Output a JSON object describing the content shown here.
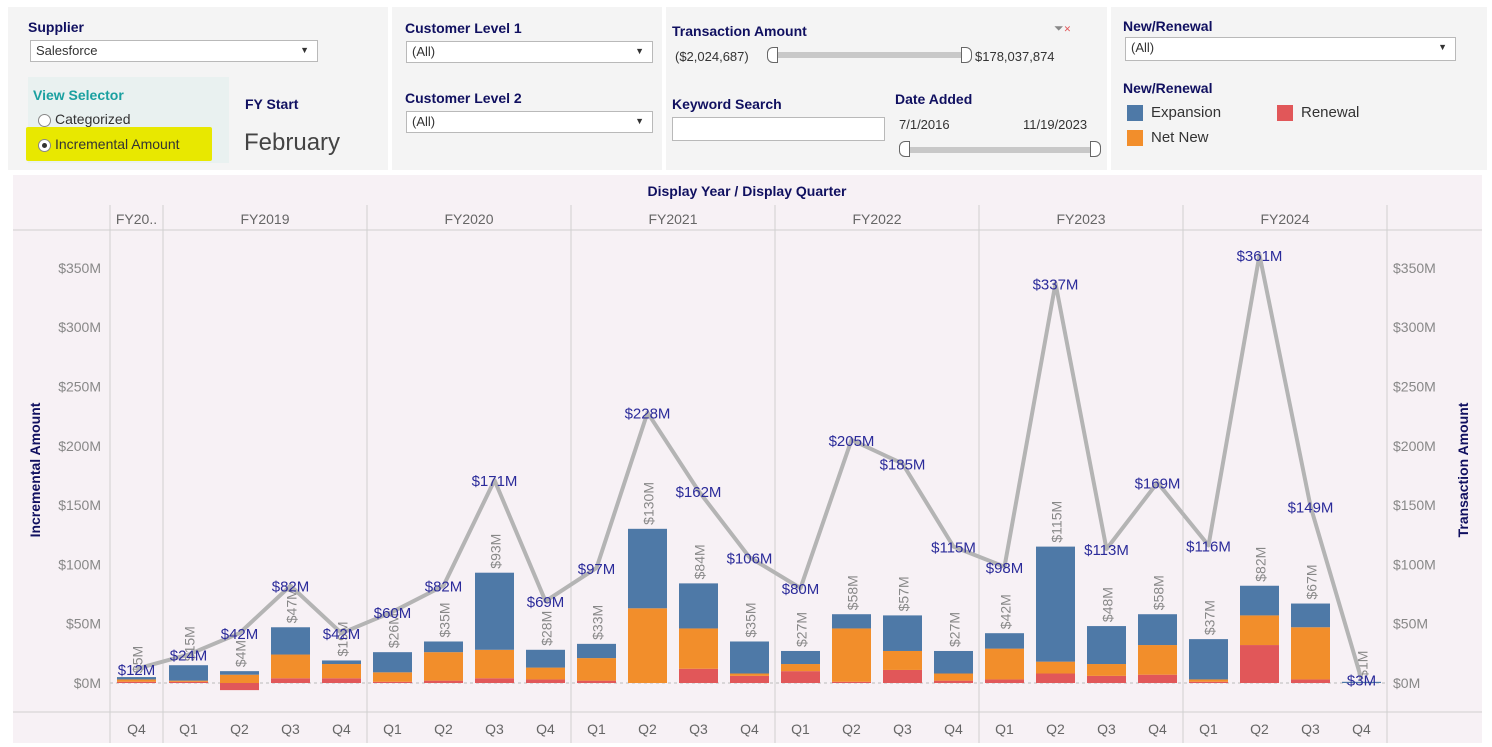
{
  "filters": {
    "supplier": {
      "label": "Supplier",
      "value": "Salesforce"
    },
    "view_selector": {
      "label": "View Selector",
      "options": [
        "Categorized",
        "Incremental Amount"
      ],
      "selected": "Incremental Amount"
    },
    "fy_start": {
      "label": "FY Start",
      "value": "February"
    },
    "customer_level_1": {
      "label": "Customer Level 1",
      "value": "(All)"
    },
    "customer_level_2": {
      "label": "Customer Level 2",
      "value": "(All)"
    },
    "transaction_amount": {
      "label": "Transaction Amount",
      "min": "($2,024,687)",
      "max": "$178,037,874"
    },
    "keyword_search": {
      "label": "Keyword Search",
      "value": ""
    },
    "date_added": {
      "label": "Date Added",
      "min": "7/1/2016",
      "max": "11/19/2023"
    },
    "new_renewal": {
      "label": "New/Renewal",
      "value": "(All)"
    },
    "legend": {
      "title": "New/Renewal",
      "items": [
        {
          "label": "Expansion",
          "color": "#4e79a7"
        },
        {
          "label": "Renewal",
          "color": "#e15759"
        },
        {
          "label": "Net New",
          "color": "#f28e2b"
        }
      ]
    }
  },
  "chart_data": {
    "type": "bar",
    "stacked": true,
    "title": "Display Year / Display Quarter",
    "ylabel": "Incremental Amount",
    "y2label": "Transaction Amount",
    "ylim": [
      -10,
      375
    ],
    "yticks": [
      "$0M",
      "$50M",
      "$100M",
      "$150M",
      "$200M",
      "$250M",
      "$300M",
      "$350M"
    ],
    "ytick_values": [
      0,
      50,
      100,
      150,
      200,
      250,
      300,
      350
    ],
    "years": [
      {
        "label": "FY20..",
        "quarters": [
          "Q4"
        ]
      },
      {
        "label": "FY2019",
        "quarters": [
          "Q1",
          "Q2",
          "Q3",
          "Q4"
        ]
      },
      {
        "label": "FY2020",
        "quarters": [
          "Q1",
          "Q2",
          "Q3",
          "Q4"
        ]
      },
      {
        "label": "FY2021",
        "quarters": [
          "Q1",
          "Q2",
          "Q3",
          "Q4"
        ]
      },
      {
        "label": "FY2022",
        "quarters": [
          "Q1",
          "Q2",
          "Q3",
          "Q4"
        ]
      },
      {
        "label": "FY2023",
        "quarters": [
          "Q1",
          "Q2",
          "Q3",
          "Q4"
        ]
      },
      {
        "label": "FY2024",
        "quarters": [
          "Q1",
          "Q2",
          "Q3",
          "Q4"
        ]
      }
    ],
    "series": [
      {
        "name": "Renewal",
        "color": "#e15759",
        "values": [
          1,
          1,
          -6,
          4,
          4,
          1,
          2,
          4,
          3,
          2,
          0,
          12,
          6,
          10,
          1,
          11,
          2,
          3,
          8,
          6,
          7,
          1,
          32,
          3,
          0
        ]
      },
      {
        "name": "Net New",
        "color": "#f28e2b",
        "values": [
          2,
          1,
          7,
          20,
          12,
          8,
          24,
          24,
          10,
          19,
          63,
          34,
          2,
          6,
          45,
          16,
          6,
          26,
          10,
          10,
          25,
          2,
          25,
          44,
          0
        ]
      },
      {
        "name": "Expansion",
        "color": "#4e79a7",
        "values": [
          2,
          13,
          3,
          23,
          3,
          17,
          9,
          65,
          15,
          12,
          67,
          38,
          27,
          11,
          12,
          30,
          19,
          13,
          97,
          32,
          26,
          34,
          25,
          20,
          1
        ]
      }
    ],
    "bar_totals": [
      "$5M",
      "$15M",
      "$4M",
      "$47M",
      "$19M",
      "$26M",
      "$35M",
      "$93M",
      "$28M",
      "$33M",
      "$130M",
      "$84M",
      "$35M",
      "$27M",
      "$58M",
      "$57M",
      "$27M",
      "$42M",
      "$115M",
      "$48M",
      "$58M",
      "$37M",
      "$82M",
      "$67M",
      "$1M"
    ],
    "line": {
      "name": "Transaction Amount",
      "color": "#b4b4b4",
      "values": [
        12,
        24,
        42,
        82,
        42,
        60,
        82,
        171,
        69,
        97,
        228,
        162,
        106,
        80,
        205,
        185,
        115,
        98,
        337,
        113,
        169,
        116,
        361,
        149,
        3
      ],
      "labels": [
        "$12M",
        "$24M",
        "$42M",
        "$82M",
        "$42M",
        "$60M",
        "$82M",
        "$171M",
        "$69M",
        "$97M",
        "$228M",
        "$162M",
        "$106M",
        "$80M",
        "$205M",
        "$185M",
        "$115M",
        "$98M",
        "$337M",
        "$113M",
        "$169M",
        "$116M",
        "$361M",
        "$149M",
        "$3M"
      ]
    }
  }
}
